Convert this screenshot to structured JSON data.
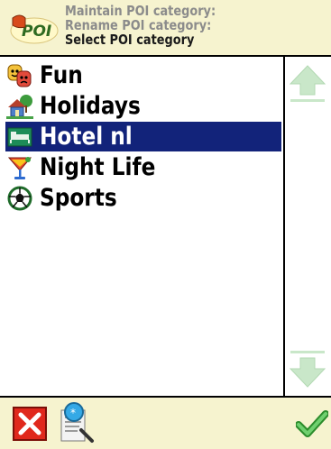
{
  "header": {
    "logo_icon": "poi-app-icon",
    "lines": [
      "Maintain POI category:",
      "Rename POI category:",
      "Select POI category"
    ]
  },
  "list": {
    "items": [
      {
        "label": "Fun",
        "icon": "theater-masks-icon",
        "selected": false
      },
      {
        "label": "Holidays",
        "icon": "house-tree-icon",
        "selected": false
      },
      {
        "label": "Hotel nl",
        "icon": "bed-icon",
        "selected": true
      },
      {
        "label": "Night Life",
        "icon": "cocktail-glass-icon",
        "selected": false
      },
      {
        "label": "Sports",
        "icon": "soccer-ball-icon",
        "selected": false
      }
    ],
    "selected_color": "#12237a"
  },
  "scrollbar": {
    "up_icon": "arrow-up-icon",
    "down_icon": "arrow-down-icon",
    "color": "#c9e7c9"
  },
  "footer": {
    "cancel_icon": "close-icon",
    "search_icon": "search-document-icon",
    "confirm_icon": "checkmark-icon"
  },
  "colors": {
    "header_bg": "#f6f3cf",
    "muted_text": "#8b8b8b",
    "cancel_red": "#e0281c",
    "confirm_green": "#3fae3f"
  }
}
